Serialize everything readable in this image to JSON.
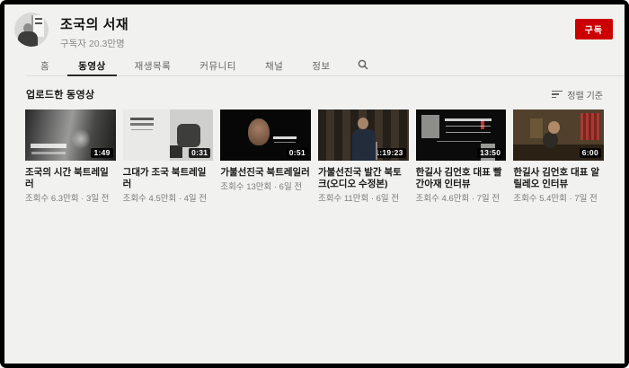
{
  "header": {
    "channel_name": "조국의 서재",
    "subscriber_count": "구독자 20.3만명",
    "subscribe_label": "구독"
  },
  "tabs": [
    {
      "label": "홈",
      "active": false
    },
    {
      "label": "동영상",
      "active": true
    },
    {
      "label": "재생목록",
      "active": false
    },
    {
      "label": "커뮤니티",
      "active": false
    },
    {
      "label": "채널",
      "active": false
    },
    {
      "label": "정보",
      "active": false
    }
  ],
  "section": {
    "title": "업로드한 동영상",
    "sort_label": "정렬 기준"
  },
  "videos": [
    {
      "title": "조국의 시간 북트레일러",
      "meta": "조회수 6.3만회 · 3일 전",
      "duration": "1:49"
    },
    {
      "title": "그대가 조국 북트레일러",
      "meta": "조회수 4.5만회 · 4일 전",
      "duration": "0:31"
    },
    {
      "title": "가불선진국 북트레일러",
      "meta": "조회수 13만회 · 6일 전",
      "duration": "0:51"
    },
    {
      "title": "가불선진국 발간 북토크(오디오 수정본)",
      "meta": "조회수 11만회 · 6일 전",
      "duration": "1:19:23"
    },
    {
      "title": "한길사 김언호 대표 빨간아재 인터뷰",
      "meta": "조회수 4.6만회 · 7일 전",
      "duration": "13:50"
    },
    {
      "title": "한길사 김언호 대표 알릴레오 인터뷰",
      "meta": "조회수 5.4만회 · 7일 전",
      "duration": "6:00"
    }
  ],
  "colors": {
    "subscribe_red": "#cc0000",
    "page_background": "#f1f1f0",
    "active_tab_underline": "#2a2a2a",
    "duration_badge": "#000000"
  }
}
